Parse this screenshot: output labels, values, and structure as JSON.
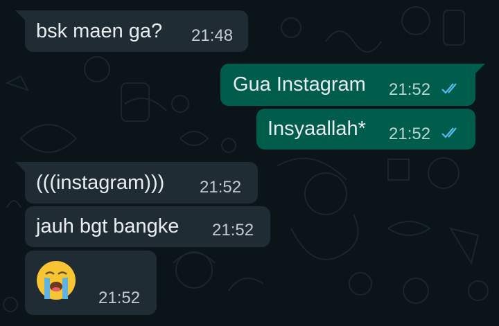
{
  "messages": [
    {
      "id": "m1",
      "side": "incoming",
      "text": "bsk maen ga?",
      "time": "21:48"
    },
    {
      "id": "m2",
      "side": "outgoing",
      "text": "Gua Instagram",
      "time": "21:52",
      "status": "read"
    },
    {
      "id": "m3",
      "side": "outgoing",
      "text": "Insyaallah*",
      "time": "21:52",
      "status": "read"
    },
    {
      "id": "m4",
      "side": "incoming",
      "text": "(((instagram)))",
      "time": "21:52"
    },
    {
      "id": "m5",
      "side": "incoming",
      "text": "jauh bgt bangke",
      "time": "21:52"
    },
    {
      "id": "m6",
      "side": "incoming",
      "text": "",
      "emoji": "loudly-crying-face-emoji",
      "time": "21:52"
    }
  ],
  "colors": {
    "background": "#0b1419",
    "incoming_bubble": "#1f2c33",
    "outgoing_bubble": "#005c4b",
    "read_ticks": "#53bdeb"
  }
}
